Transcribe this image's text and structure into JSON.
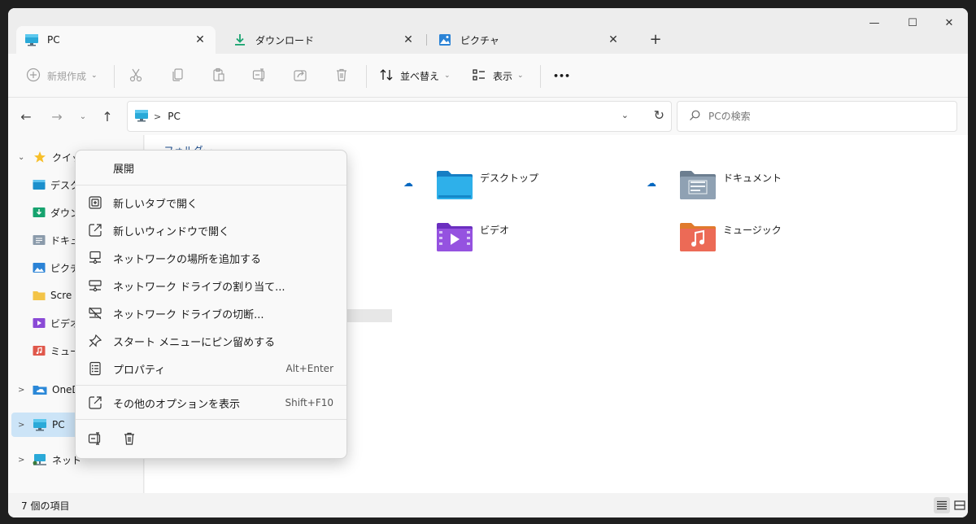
{
  "tabs": [
    {
      "label": "PC",
      "icon": "pc-icon"
    },
    {
      "label": "ダウンロード",
      "icon": "download-icon"
    },
    {
      "label": "ピクチャ",
      "icon": "pictures-icon"
    }
  ],
  "window_controls": {
    "minimize": "—",
    "maximize": "☐",
    "close": "✕"
  },
  "toolbar": {
    "new_label": "新規作成",
    "sort_label": "並べ替え",
    "view_label": "表示",
    "more_label": "•••"
  },
  "address": {
    "path": "PC"
  },
  "search": {
    "placeholder": "PCの検索"
  },
  "sidebar": {
    "items": [
      {
        "label": "クイック",
        "icon": "star-icon"
      },
      {
        "label": "デスク",
        "icon": "desktop-folder-icon"
      },
      {
        "label": "ダウン",
        "icon": "downloads-folder-icon"
      },
      {
        "label": "ドキュ",
        "icon": "documents-folder-icon"
      },
      {
        "label": "ピクチ",
        "icon": "pictures-folder-icon"
      },
      {
        "label": "Scre",
        "icon": "folder-icon"
      },
      {
        "label": "ビデオ",
        "icon": "videos-folder-icon"
      },
      {
        "label": "ミュー",
        "icon": "music-folder-icon"
      },
      {
        "label": "OneD",
        "icon": "onedrive-icon"
      },
      {
        "label": "PC",
        "icon": "pc-icon"
      },
      {
        "label": "ネット",
        "icon": "network-icon"
      }
    ]
  },
  "main": {
    "group_header": "フォルダー",
    "folders": [
      {
        "label": "デスクトップ",
        "icon": "desktop-folder-icon",
        "cloud": true
      },
      {
        "label": "ドキュメント",
        "icon": "documents-folder-icon",
        "cloud": true
      },
      {
        "label": "ビデオ",
        "icon": "videos-folder-icon",
        "cloud": false
      },
      {
        "label": "ミュージック",
        "icon": "music-folder-icon",
        "cloud": false
      }
    ]
  },
  "context_menu": {
    "header": "展開",
    "items": [
      {
        "label": "新しいタブで開く",
        "icon": "new-tab-icon",
        "shortcut": ""
      },
      {
        "label": "新しいウィンドウで開く",
        "icon": "new-window-icon",
        "shortcut": ""
      },
      {
        "label": "ネットワークの場所を追加する",
        "icon": "network-location-icon",
        "shortcut": ""
      },
      {
        "label": "ネットワーク ドライブの割り当て...",
        "icon": "map-drive-icon",
        "shortcut": ""
      },
      {
        "label": "ネットワーク ドライブの切断...",
        "icon": "disconnect-drive-icon",
        "shortcut": ""
      },
      {
        "label": "スタート メニューにピン留めする",
        "icon": "pin-icon",
        "shortcut": ""
      },
      {
        "label": "プロパティ",
        "icon": "properties-icon",
        "shortcut": "Alt+Enter"
      },
      {
        "label": "その他のオプションを表示",
        "icon": "more-options-icon",
        "shortcut": "Shift+F10"
      }
    ]
  },
  "status": {
    "count": "7 個の項目"
  },
  "colors": {
    "accent": "#0067c0",
    "selected": "#cce4f7",
    "window_bg": "#f3f3f3"
  }
}
